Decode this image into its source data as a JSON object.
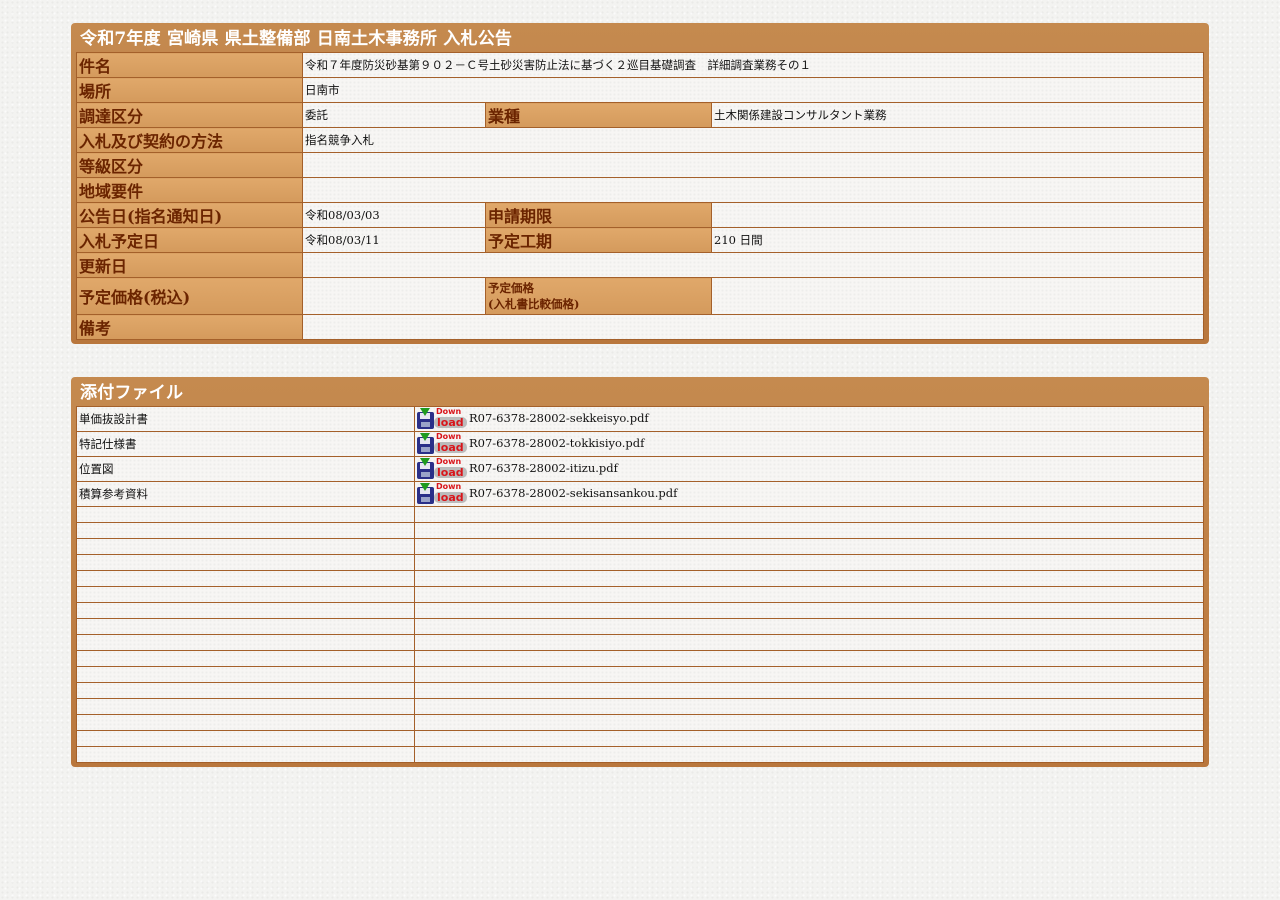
{
  "notice": {
    "title": "令和7年度  宮崎県  県土整備部  日南土木事務所  入札公告",
    "labels": {
      "subject": "件名",
      "location": "場所",
      "procurement_category": "調達区分",
      "business_type": "業種",
      "bidding_method": "入札及び契約の方法",
      "grade_category": "等級区分",
      "regional_requirement": "地域要件",
      "announcement_date": "公告日(指名通知日)",
      "application_period": "申請期限",
      "bid_date": "入札予定日",
      "construction_period": "予定工期",
      "update_date": "更新日",
      "planned_price_tax": "予定価格(税込)",
      "planned_price_bid_line1": "予定価格",
      "planned_price_bid_line2": "(入札書比較価格)",
      "remarks": "備考"
    },
    "values": {
      "subject": "令和７年度防災砂基第９０２－Ｃ号土砂災害防止法に基づく２巡目基礎調査　詳細調査業務その１",
      "location": "日南市",
      "procurement_category": "委託",
      "business_type": "土木関係建設コンサルタント業務",
      "bidding_method": "指名競争入札",
      "grade_category": "",
      "regional_requirement": "",
      "announcement_date": "令和08/03/03",
      "application_period": "",
      "bid_date": "令和08/03/11",
      "construction_period": "210 日間",
      "update_date": "",
      "planned_price_tax": "",
      "planned_price_bid": "",
      "remarks": ""
    }
  },
  "attachments": {
    "title": "添付ファイル",
    "download_icon": {
      "name": "download-icon",
      "text_top": "Down",
      "text_bottom": "load"
    },
    "files": [
      {
        "name": "単価抜設計書",
        "filename": "R07-6378-28002-sekkeisyo.pdf"
      },
      {
        "name": "特記仕様書",
        "filename": "R07-6378-28002-tokkisiyo.pdf"
      },
      {
        "name": "位置図",
        "filename": "R07-6378-28002-itizu.pdf"
      },
      {
        "name": "積算参考資料",
        "filename": "R07-6378-28002-sekisansankou.pdf"
      }
    ]
  },
  "colors": {
    "panel": "#c07f45",
    "label_bg": "#d9a062",
    "label_text": "#6b2400",
    "border": "#a4602a"
  }
}
